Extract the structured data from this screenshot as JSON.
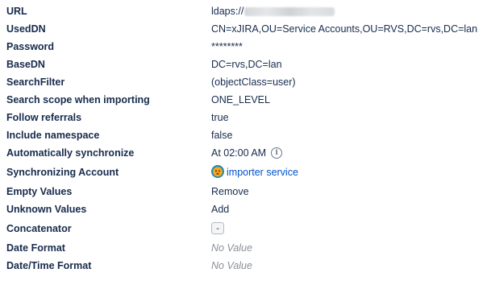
{
  "properties": {
    "url": {
      "label": "URL",
      "value": "ldaps://"
    },
    "used_dn": {
      "label": "UsedDN",
      "value": "CN=xJIRA,OU=Service Accounts,OU=RVS,DC=rvs,DC=lan"
    },
    "password": {
      "label": "Password",
      "value": "********"
    },
    "base_dn": {
      "label": "BaseDN",
      "value": "DC=rvs,DC=lan"
    },
    "search_filter": {
      "label": "SearchFilter",
      "value": "(objectClass=user)"
    },
    "search_scope": {
      "label": "Search scope when importing",
      "value": "ONE_LEVEL"
    },
    "follow_referrals": {
      "label": "Follow referrals",
      "value": "true"
    },
    "include_namespace": {
      "label": "Include namespace",
      "value": "false"
    },
    "auto_sync": {
      "label": "Automatically synchronize",
      "value": "At 02:00 AM",
      "icon": "info-icon"
    },
    "sync_account": {
      "label": "Synchronizing Account",
      "value": "importer service",
      "icon": "user-avatar"
    },
    "empty_values": {
      "label": "Empty Values",
      "value": "Remove"
    },
    "unknown_values": {
      "label": "Unknown Values",
      "value": "Add"
    },
    "concatenator": {
      "label": "Concatenator",
      "value": "-"
    },
    "date_format": {
      "label": "Date Format",
      "value": "No Value"
    },
    "datetime_format": {
      "label": "Date/Time Format",
      "value": "No Value"
    }
  },
  "colors": {
    "text": "#172b4d",
    "link": "#0052cc",
    "muted": "#8a8f98",
    "avatar": "#f5a623"
  }
}
